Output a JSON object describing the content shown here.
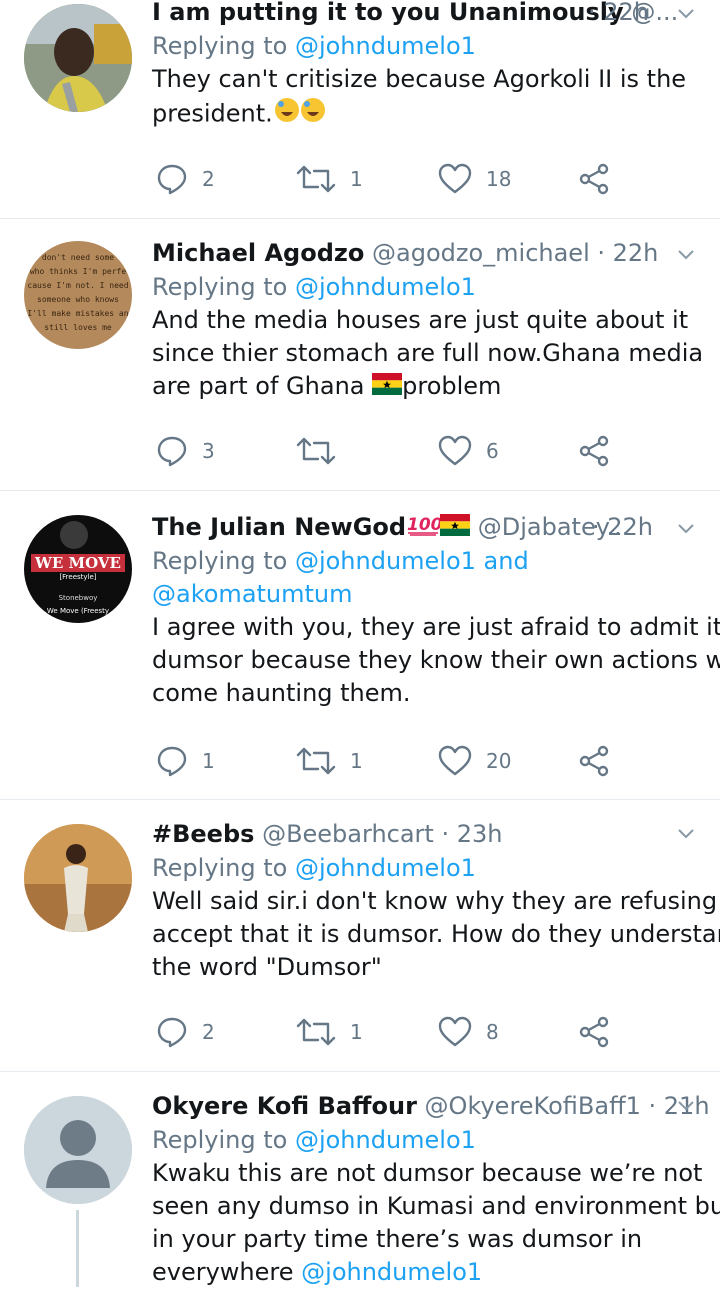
{
  "tweets": [
    {
      "name": "I am putting it to you Unanimously",
      "handle": "@...",
      "time": "· 22h",
      "replying_prefix": "Replying to ",
      "replying_to": "@johndumelo1",
      "text_lines": [
        "They can't critisize because Agorkoli II is the",
        "president."
      ],
      "replies": "2",
      "retweets": "1",
      "likes": "18"
    },
    {
      "name": "Michael Agodzo",
      "handle": "@agodzo_michael",
      "time": "· 22h",
      "replying_prefix": "Replying to ",
      "replying_to": "@johndumelo1",
      "text_lines": [
        "And the media houses are just quite about it",
        "since thier stomach are full now.Ghana media",
        "are part of Ghana",
        "problem"
      ],
      "avatar_text": [
        "don't need some",
        "who thinks I'm perfe",
        "cause I'm not. I need",
        "someone who knows",
        "I'll make mistakes an",
        "still loves me"
      ],
      "replies": "3",
      "retweets": "",
      "likes": "6"
    },
    {
      "name": "The Julian NewGod",
      "handle": "@Djabatey...",
      "time": "· 22h",
      "replying_prefix": "Replying to ",
      "replying_to": "@johndumelo1",
      "replying_and": " and",
      "replying_to2": "@akomatumtum",
      "text_lines": [
        "I agree with you, they are just afraid to admit it is",
        "dumsor because they know their own actions will",
        "come haunting them."
      ],
      "avatar_text": [
        "WE MOVE",
        "[Freestyle]",
        "Stonebwoy",
        "We Move (Freesty"
      ],
      "replies": "1",
      "retweets": "1",
      "likes": "20"
    },
    {
      "name": "#Beebs",
      "handle": "@Beebarhcart",
      "time": "· 23h",
      "replying_prefix": "Replying to ",
      "replying_to": "@johndumelo1",
      "text_lines": [
        "Well said sir.i don't know why they are refusing to",
        "accept that it is dumsor. How do they understand",
        "the word \"Dumsor\""
      ],
      "replies": "2",
      "retweets": "1",
      "likes": "8"
    },
    {
      "name": "Okyere Kofi Baffour",
      "handle": "@OkyereKofiBaff1",
      "time": "· 21h",
      "replying_prefix": "Replying to ",
      "replying_to": "@johndumelo1",
      "text_lines": [
        "Kwaku this are not dumsor because we’re not",
        "seen any dumso in Kumasi and environment but",
        "in your party time there’s was dumsor in",
        "everywhere"
      ],
      "text_tail_mention": "@johndumelo1"
    }
  ],
  "icons": {
    "reply": "reply-icon",
    "retweet": "retweet-icon",
    "like": "heart-icon",
    "share": "share-icon",
    "caret": "chevron-down-icon"
  },
  "colors": {
    "accent": "#1da1f2",
    "secondary_text": "#657786",
    "separator": "#e6ecf0"
  }
}
